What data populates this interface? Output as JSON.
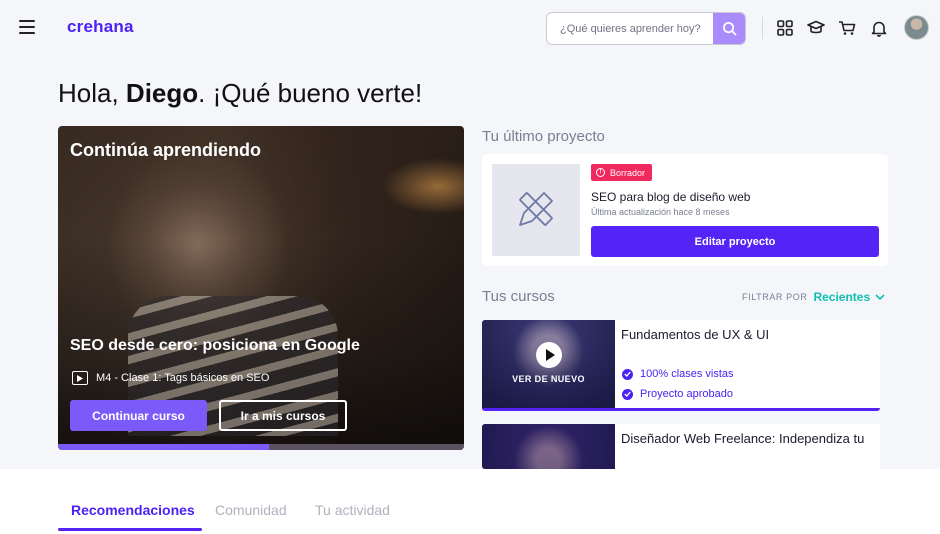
{
  "header": {
    "logo": "crehana",
    "search": {
      "placeholder": "¿Qué quieres aprender hoy?"
    },
    "icons": [
      "menu-icon",
      "search-icon",
      "grid-icon",
      "graduation-cap-icon",
      "cart-icon",
      "bell-icon",
      "avatar"
    ]
  },
  "greeting": {
    "prefix": "Hola, ",
    "name": "Diego",
    "suffix": ". ¡Qué bueno verte!"
  },
  "continue_card": {
    "title": "Continúa aprendiendo",
    "course": "SEO desde cero: posiciona en Google",
    "lesson": "M4 - Clase 1: Tags básicos en SEO",
    "continue_button": "Continuar curso",
    "my_courses_button": "Ir a mis cursos",
    "progress": 0.52
  },
  "last_project": {
    "section_title": "Tu último proyecto",
    "badge": "Borrador",
    "title": "SEO para blog de diseño web",
    "updated": "Última actualización hace 8 meses",
    "edit_button": "Editar proyecto"
  },
  "courses": {
    "section_title": "Tus cursos",
    "filter_label": "FILTRAR POR",
    "filter_value": "Recientes",
    "items": [
      {
        "title": "Fundamentos de UX & UI",
        "overlay": "VER DE NUEVO",
        "stat1": "100% clases vistas",
        "stat2": "Proyecto aprobado"
      },
      {
        "title": "Diseñador Web Freelance: Independiza tu"
      }
    ]
  },
  "tabs": [
    {
      "label": "Recomendaciones",
      "active": true
    },
    {
      "label": "Comunidad",
      "active": false
    },
    {
      "label": "Tu actividad",
      "active": false
    }
  ],
  "colors": {
    "brand": "#4b22f4",
    "accent_teal": "#0fc0b0",
    "badge_red": "#f0295e"
  }
}
